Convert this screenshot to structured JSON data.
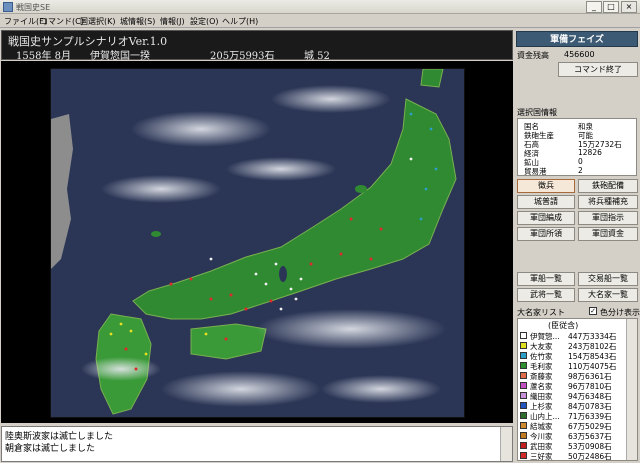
{
  "window": {
    "title": "戦国史SE",
    "min": "_",
    "max": "□",
    "close": "×"
  },
  "menu": [
    "ファイル(F)",
    "コマンド(C)",
    "国選択(K)",
    "城情報(S)",
    "情報(J)",
    "設定(O)",
    "ヘルプ(H)"
  ],
  "header": {
    "title": "戦国史サンプルシナリオVer.1.0",
    "date": "1558年 8月",
    "country": "伊賀惣国一揆",
    "koku": "205万5993石",
    "castles": "城 52"
  },
  "log": [
    "陸奥斯波家は滅亡しました",
    "朝倉家は滅亡しました"
  ],
  "panel": {
    "phase": "軍備フェイズ",
    "funds_label": "資金残高",
    "funds_value": "456600",
    "end_command": "コマンド終了",
    "country_info_title": "選択国情報",
    "country_info": [
      {
        "label": "国名",
        "value": "和泉"
      },
      {
        "label": "鉄砲生産",
        "value": "可能"
      },
      {
        "label": "石高",
        "value": "15万2732石"
      },
      {
        "label": "経済",
        "value": "12826"
      },
      {
        "label": "鉱山",
        "value": "0"
      },
      {
        "label": "貿易港",
        "value": "2"
      }
    ],
    "buttons": [
      "徴兵",
      "鉄砲配備",
      "城普請",
      "将兵種補充",
      "軍団編成",
      "軍団指示",
      "軍団所領",
      "軍団資金"
    ],
    "list_buttons": [
      "軍船一覧",
      "交易船一覧",
      "武将一覧",
      "大名家一覧"
    ],
    "daimyo_list_label": "大名家リスト",
    "color_display_label": "色分け表示",
    "list_head": "(臣従含)",
    "daimyo": [
      {
        "name": "伊賀惣...",
        "value": "447万3334石",
        "color": "#ffffff"
      },
      {
        "name": "大友家",
        "value": "243万8102石",
        "color": "#e0e020"
      },
      {
        "name": "佐竹家",
        "value": "154万8543石",
        "color": "#2aa0c8"
      },
      {
        "name": "毛利家",
        "value": "110万4075石",
        "color": "#2e8f2e"
      },
      {
        "name": "斎藤家",
        "value": "98万6361石",
        "color": "#e06a4a"
      },
      {
        "name": "蘆名家",
        "value": "96万7810石",
        "color": "#c050c0"
      },
      {
        "name": "織田家",
        "value": "94万6348石",
        "color": "#c890d8"
      },
      {
        "name": "上杉家",
        "value": "84万0783石",
        "color": "#2255c0"
      },
      {
        "name": "山内上...",
        "value": "71万6339石",
        "color": "#2e6d2e"
      },
      {
        "name": "結城家",
        "value": "67万5029石",
        "color": "#d08a2e"
      },
      {
        "name": "今川家",
        "value": "63万5637石",
        "color": "#c07a20"
      },
      {
        "name": "武田家",
        "value": "53万0908石",
        "color": "#c02020"
      },
      {
        "name": "三好家",
        "value": "50万2486石",
        "color": "#d02a2a"
      }
    ]
  }
}
